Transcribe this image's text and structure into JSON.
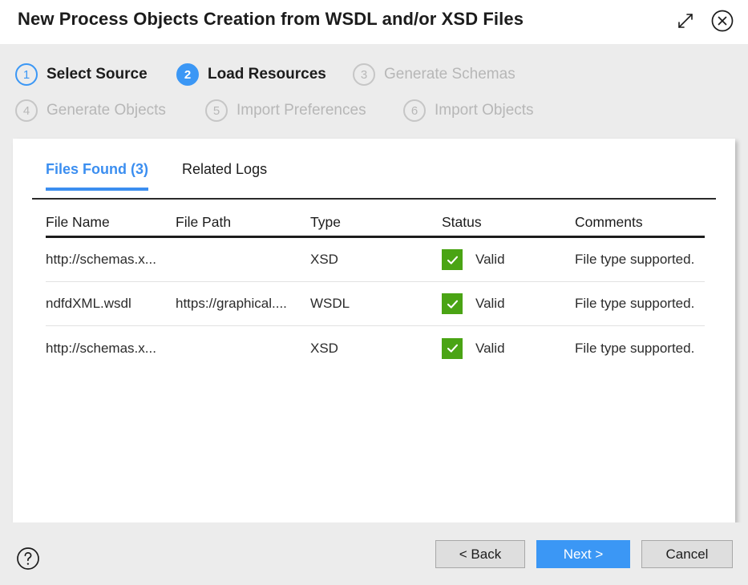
{
  "window": {
    "title": "New Process Objects Creation from WSDL and/or XSD Files",
    "expand_icon": "expand-diagonal-icon",
    "close_icon": "close-circle-icon"
  },
  "steps": [
    {
      "number": "1",
      "label": "Select Source",
      "state": "done"
    },
    {
      "number": "2",
      "label": "Load Resources",
      "state": "current"
    },
    {
      "number": "3",
      "label": "Generate Schemas",
      "state": "pending"
    },
    {
      "number": "4",
      "label": "Generate Objects",
      "state": "pending"
    },
    {
      "number": "5",
      "label": "Import Preferences",
      "state": "pending"
    },
    {
      "number": "6",
      "label": "Import Objects",
      "state": "pending"
    }
  ],
  "tabs": [
    {
      "label": "Files Found (3)",
      "active": true
    },
    {
      "label": "Related Logs",
      "active": false
    }
  ],
  "table": {
    "columns": [
      "File Name",
      "File Path",
      "Type",
      "Status",
      "Comments"
    ],
    "rows": [
      {
        "file_name": "http://schemas.x...",
        "file_path": "",
        "type": "XSD",
        "status": "Valid",
        "status_icon": "check-square-icon",
        "comments": "File type supported."
      },
      {
        "file_name": "ndfdXML.wsdl",
        "file_path": "https://graphical....",
        "type": "WSDL",
        "status": "Valid",
        "status_icon": "check-square-icon",
        "comments": "File type supported."
      },
      {
        "file_name": "http://schemas.x...",
        "file_path": "",
        "type": "XSD",
        "status": "Valid",
        "status_icon": "check-square-icon",
        "comments": "File type supported."
      }
    ]
  },
  "footer": {
    "help_icon": "help-circle-icon",
    "back_label": "< Back",
    "next_label": "Next >",
    "cancel_label": "Cancel"
  },
  "colors": {
    "accent_blue": "#3b97f5",
    "tab_blue": "#3b8ef0",
    "status_green": "#4aa414",
    "background_grey": "#ececec",
    "pending_grey": "#b7b7b7"
  }
}
